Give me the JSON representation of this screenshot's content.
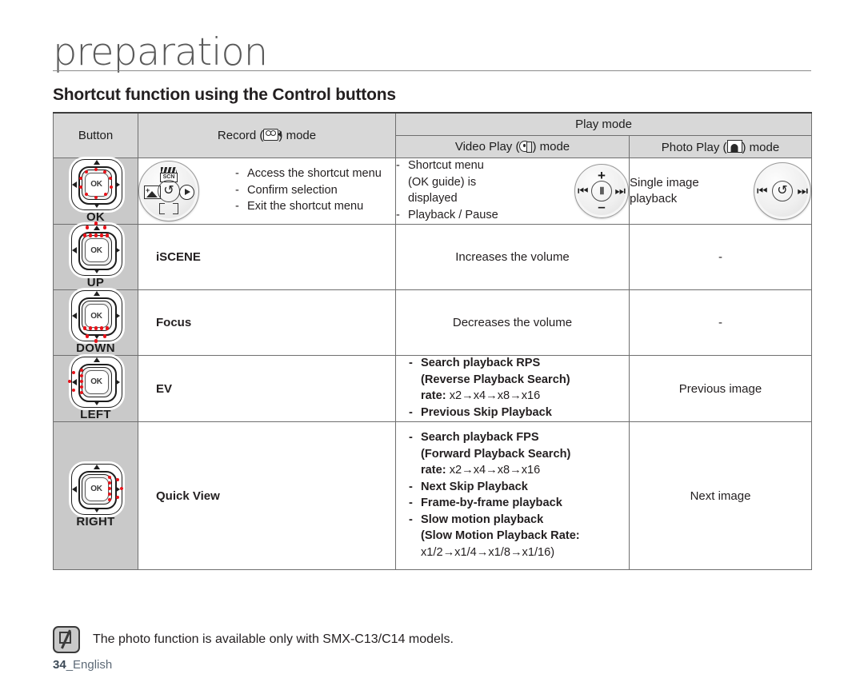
{
  "header": {
    "chapter": "preparation",
    "section": "Shortcut function using the Control buttons"
  },
  "table": {
    "col_button": "Button",
    "col_record_pre": "Record (",
    "col_record_post": ") mode",
    "col_play": "Play mode",
    "col_video_pre": "Video Play (",
    "col_video_post": ") mode",
    "col_photo_pre": "Photo Play (",
    "col_photo_post": ") mode",
    "rows": [
      {
        "button": "OK",
        "ok_label": "OK",
        "record_items": [
          "Access the shortcut menu",
          "Confirm selection",
          "Exit the shortcut menu"
        ],
        "video_items": [
          "Shortcut menu",
          "(OK guide) is",
          "displayed",
          "Playback / Pause"
        ],
        "photo_text": "Single image\nplayback"
      },
      {
        "button": "UP",
        "ok_label": "OK",
        "record_text": "iSCENE",
        "video_text": "Increases the volume",
        "photo_text": "-"
      },
      {
        "button": "DOWN",
        "ok_label": "OK",
        "record_text": "Focus",
        "video_text": "Decreases the volume",
        "photo_text": "-"
      },
      {
        "button": "LEFT",
        "ok_label": "OK",
        "record_text": "EV",
        "video_items": [
          "Search playback RPS",
          "(Reverse Playback Search)",
          "rate: x2→x4→x8→x16",
          "Previous Skip Playback"
        ],
        "photo_text": "Previous image"
      },
      {
        "button": "RIGHT",
        "ok_label": "OK",
        "record_text": "Quick View",
        "video_items": [
          "Search playback FPS",
          "(Forward Playback Search)",
          "rate: x2→x4→x8→x16",
          "Next Skip Playback",
          "Frame-by-frame playback",
          "Slow motion playback",
          "(Slow Motion Playback Rate:",
          "x1/2→x1/4→x1/8→x1/16)"
        ],
        "photo_text": "Next image"
      }
    ]
  },
  "row1": {
    "rec_1": "Access the shortcut menu",
    "rec_2": "Confirm selection",
    "rec_3": "Exit the shortcut menu",
    "vid_1": "Shortcut menu",
    "vid_2": "(OK guide) is",
    "vid_3": "displayed",
    "vid_4": "Playback / Pause",
    "pho_1": "Single image",
    "pho_2": "playback",
    "scn_label": "SCN",
    "ev_sign": "+",
    "pause_glyph": "Ⅱ",
    "prev_glyph": "⏮",
    "next_glyph": "⏭",
    "plus": "+",
    "minus": "–",
    "back_glyph": "↺"
  },
  "row2": {
    "rec": "iSCENE",
    "vid": "Increases the volume",
    "pho": "-"
  },
  "row3": {
    "rec": "Focus",
    "vid": "Decreases the volume",
    "pho": "-"
  },
  "row4": {
    "rec": "EV",
    "vid_1": "Search playback RPS",
    "vid_2": "(Reverse Playback Search)",
    "vid_3a": "rate:",
    "vid_3b": " x2→x4→x8→x16",
    "vid_4": "Previous Skip Playback",
    "pho": "Previous image"
  },
  "row5": {
    "rec": "Quick View",
    "vid_1": "Search playback FPS",
    "vid_2": "(Forward Playback Search)",
    "vid_3a": "rate:",
    "vid_3b": " x2→x4→x8→x16",
    "vid_4": "Next Skip Playback",
    "vid_5": "Frame-by-frame playback",
    "vid_6": "Slow motion playback",
    "vid_7": "(Slow Motion Playback Rate:",
    "vid_8": "x1/2→x1/4→x1/8→x1/16)",
    "pho": "Next image"
  },
  "labels": {
    "ok": "OK",
    "up": "UP",
    "down": "DOWN",
    "left": "LEFT",
    "right": "RIGHT",
    "ok_text": "OK"
  },
  "footer": {
    "note": "The photo function is available only with SMX-C13/C14 models.",
    "page_number": "34",
    "page_lang": "_English"
  },
  "colors": {
    "header_bg": "#d8d8d8",
    "button_col_bg": "#c9c9c9",
    "accent_red": "#e8131a",
    "border": "#6f6f6f",
    "text": "#231f20",
    "page_num": "#5d6a77"
  }
}
